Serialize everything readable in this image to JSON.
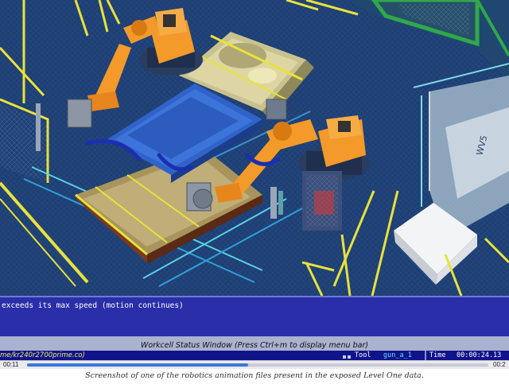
{
  "message_log": {
    "line": "exceeds its max speed (motion continues)"
  },
  "status_window": {
    "title": "Workcell Status Window  (Press Ctrl+m to display menu bar)",
    "file": "me/kr240r2700prime.co)",
    "tool_label": "Tool",
    "tool_value": "gun_a_1",
    "time_label": "Time",
    "time_value": "00:00:24.13"
  },
  "playback": {
    "elapsed": "00:11",
    "total": "00:2",
    "progress_percent": 48
  },
  "caption": "Screenshot of one of the robotics animation files present in the exposed Level One data.",
  "viewport": {
    "wall_label": "WV5",
    "colors": {
      "background": "#1e3f73",
      "robot_orange": "#f39a2a",
      "fence_yellow": "#e8e23a",
      "body_in_white": "#c9c28f",
      "fixture_blue": "#2f63c9"
    }
  }
}
